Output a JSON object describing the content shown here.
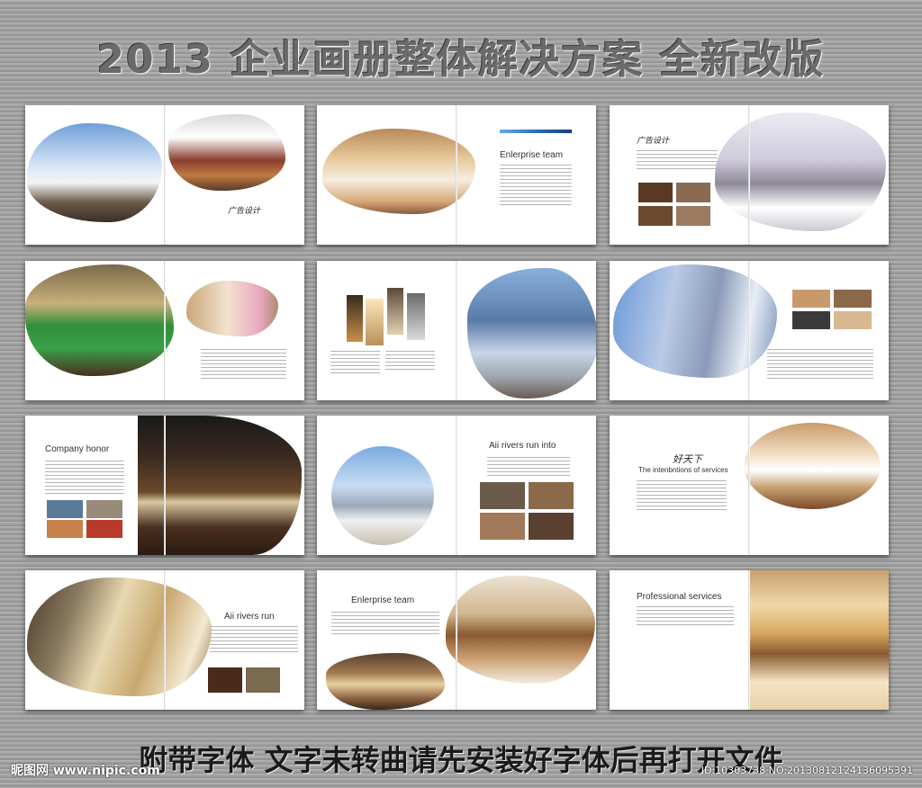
{
  "banner": {
    "title": "2013 企业画册整体解决方案  全新改版",
    "footer": "附带字体 文字未转曲请先安装好字体后再打开文件",
    "watermark_left": "昵图网 www.nipic.com",
    "watermark_right": "ID:10303738 NO:20130812124136095391"
  },
  "spreads": {
    "s1": {
      "script": "广告设计"
    },
    "s2": {
      "heading": "Enlerprise team"
    },
    "s3": {
      "script": "广告设计"
    },
    "s7": {
      "heading": "Company honor"
    },
    "s8": {
      "heading": "Aii rivers run into"
    },
    "s9": {
      "script": "好天下",
      "subheading": "The intenbntions of services"
    },
    "s10": {
      "heading": "Aii rivers run"
    },
    "s11": {
      "heading": "Enlerprise team"
    },
    "s12": {
      "heading": "Professional services"
    }
  },
  "colors": {
    "accent_bar": "#2c6fb8",
    "felt": "#2f8f3a"
  }
}
